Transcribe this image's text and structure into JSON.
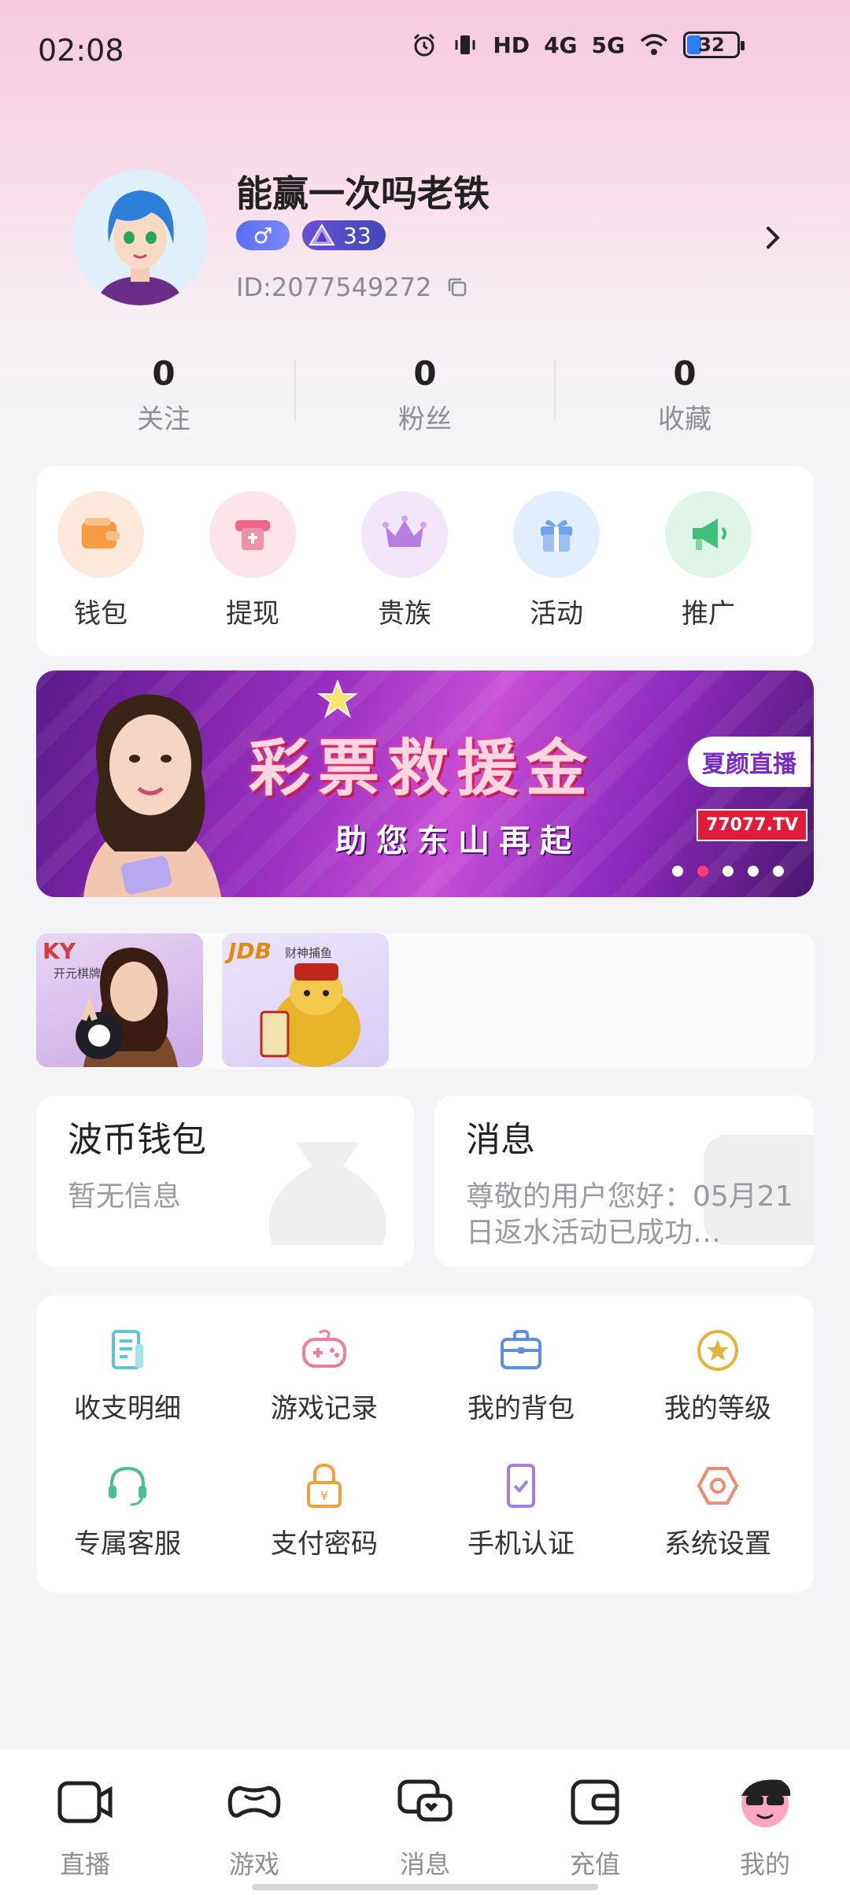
{
  "status_bar": {
    "time": "02:08",
    "network_1": "4G",
    "network_2": "5G",
    "battery": "32",
    "hd_label": "HD"
  },
  "profile": {
    "nickname": "能赢一次吗老铁",
    "gender_symbol": "♂",
    "level": "33",
    "user_id": "ID:2077549272"
  },
  "stats": [
    {
      "value": "0",
      "label": "关注"
    },
    {
      "value": "0",
      "label": "粉丝"
    },
    {
      "value": "0",
      "label": "收藏"
    }
  ],
  "quick_actions": [
    {
      "label": "钱包",
      "icon": "wallet-icon",
      "bg": "#fde9dc",
      "color": "#f59a45"
    },
    {
      "label": "提现",
      "icon": "withdraw-icon",
      "bg": "#fde3ea",
      "color": "#f0668a"
    },
    {
      "label": "贵族",
      "icon": "crown-icon",
      "bg": "#f2e6fa",
      "color": "#b57ee0"
    },
    {
      "label": "活动",
      "icon": "gift-icon",
      "bg": "#e3eefc",
      "color": "#6fa2ee"
    },
    {
      "label": "推广",
      "icon": "megaphone-icon",
      "bg": "#dff5e8",
      "color": "#3fc07a"
    }
  ],
  "banner": {
    "title": "彩票救援金",
    "subtitle": "助您东山再起",
    "tag": "夏颜直播",
    "site": "77077.TV",
    "active_dot": 1,
    "dot_count": 5
  },
  "games": [
    {
      "logo": "KY",
      "name": "开元棋牌"
    },
    {
      "logo": "JDB",
      "name": "财神捕鱼"
    }
  ],
  "wallet": {
    "title": "波币钱包",
    "text": "暂无信息"
  },
  "messages": {
    "title": "消息",
    "text": "尊敬的用户您好：05月21日返水活动已成功…"
  },
  "functions": [
    {
      "label": "收支明细",
      "icon": "ledger-icon",
      "color": "#5ec3d9"
    },
    {
      "label": "游戏记录",
      "icon": "gamepad-icon",
      "color": "#f07b9a"
    },
    {
      "label": "我的背包",
      "icon": "backpack-icon",
      "color": "#5e8de6"
    },
    {
      "label": "我的等级",
      "icon": "level-star-icon",
      "color": "#e4b43a"
    },
    {
      "label": "专属客服",
      "icon": "headset-icon",
      "color": "#49c08c"
    },
    {
      "label": "支付密码",
      "icon": "lock-icon",
      "color": "#f0a040"
    },
    {
      "label": "手机认证",
      "icon": "phone-check-icon",
      "color": "#a57ce0"
    },
    {
      "label": "系统设置",
      "icon": "settings-icon",
      "color": "#f08a70"
    }
  ],
  "tabs": [
    {
      "label": "直播",
      "icon": "live-camera-icon"
    },
    {
      "label": "游戏",
      "icon": "game-controller-icon"
    },
    {
      "label": "消息",
      "icon": "chat-icon"
    },
    {
      "label": "充值",
      "icon": "recharge-wallet-icon"
    },
    {
      "label": "我的",
      "icon": "profile-avatar-icon"
    }
  ]
}
